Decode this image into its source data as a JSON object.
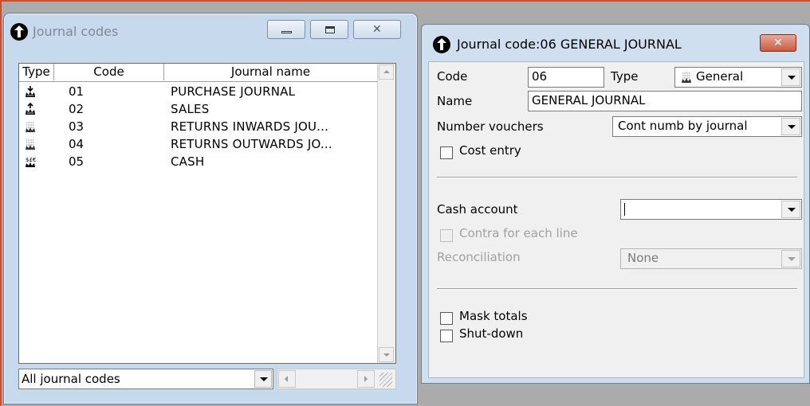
{
  "list_window": {
    "title": "Journal codes",
    "columns": [
      "Type",
      "Code",
      "Journal name"
    ],
    "rows": [
      {
        "code": "01",
        "name": "PURCHASE JOURNAL",
        "type_icon": "purchase-journal-icon"
      },
      {
        "code": "02",
        "name": "SALES",
        "type_icon": "sales-journal-icon"
      },
      {
        "code": "03",
        "name": "RETURNS INWARDS JOU...",
        "type_icon": "general-journal-icon"
      },
      {
        "code": "04",
        "name": "RETURNS OUTWARDS JO...",
        "type_icon": "general-journal-icon"
      },
      {
        "code": "05",
        "name": "CASH",
        "type_icon": "cash-journal-icon"
      }
    ],
    "filter_value": "All journal codes"
  },
  "detail_window": {
    "title": "Journal code:06 GENERAL JOURNAL",
    "close_label": "✕",
    "code_label": "Code",
    "code_value": "06",
    "type_label": "Type",
    "type_value": "General",
    "name_label": "Name",
    "name_value": "GENERAL JOURNAL",
    "number_vouchers_label": "Number vouchers",
    "number_vouchers_value": "Cont numb by journal",
    "cost_entry_label": "Cost entry",
    "cash_account_label": "Cash account",
    "cash_account_value": "",
    "contra_label": "Contra for each line",
    "reconciliation_label": "Reconciliation",
    "reconciliation_value": "None",
    "mask_totals_label": "Mask totals",
    "shutdown_label": "Shut-down"
  },
  "colors": {
    "window_frame": "#c7d9ec",
    "desktop": "#ababab",
    "close_button": "#c95a40"
  }
}
